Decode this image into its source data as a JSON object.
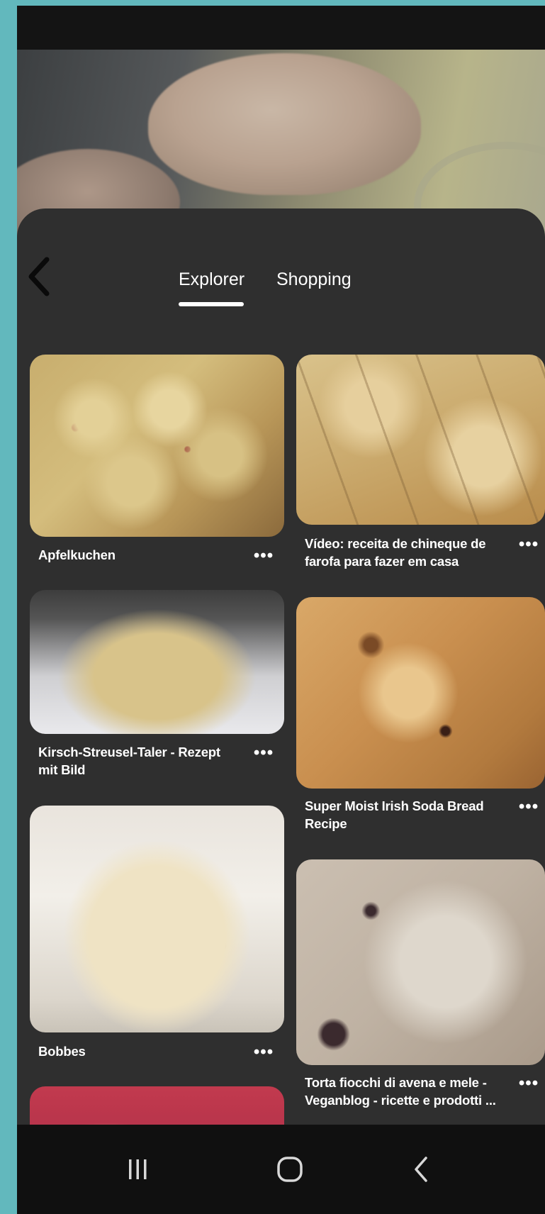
{
  "tabs": [
    {
      "label": "Explorer",
      "active": true
    },
    {
      "label": "Shopping",
      "active": false
    }
  ],
  "pins": [
    {
      "title": "Apfelkuchen",
      "more": "•••"
    },
    {
      "title": "Vídeo: receita de chineque de farofa para fazer em casa",
      "more": "•••"
    },
    {
      "title": "Kirsch-Streusel-Taler - Rezept mit Bild",
      "more": "•••"
    },
    {
      "title": "Super Moist Irish Soda Bread Recipe",
      "more": "•••"
    },
    {
      "title": "Bobbes",
      "more": "•••"
    },
    {
      "title": "Torta fiocchi di avena e mele - Veganblog - ricette e prodotti ...",
      "more": "•••"
    }
  ],
  "icons": {
    "back": "chevron-left-icon",
    "nav_recent": "recent-apps-icon",
    "nav_home": "home-icon",
    "nav_back": "back-icon"
  },
  "colors": {
    "accent_teal": "#62b8bd",
    "sheet": "#2f2f2f",
    "text": "#ffffff"
  }
}
